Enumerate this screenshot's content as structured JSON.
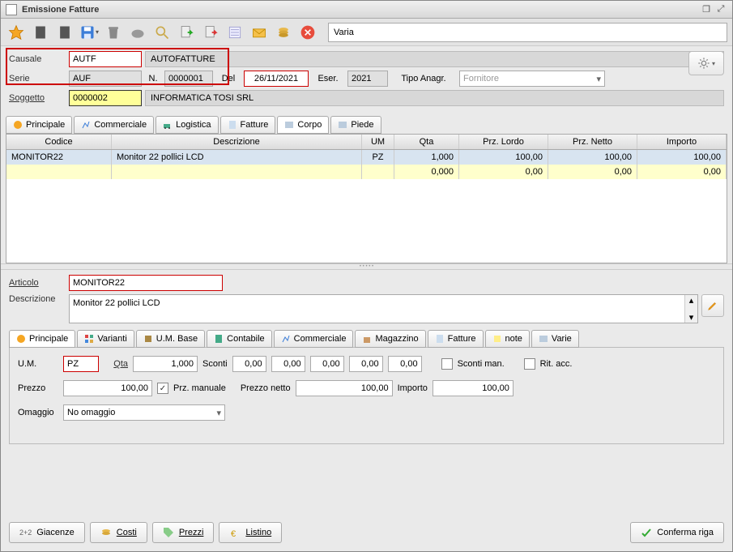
{
  "window": {
    "title": "Emissione Fatture"
  },
  "toolbar": {
    "varia_label": "Varia"
  },
  "header": {
    "causale_label": "Causale",
    "causale_value": "AUTF",
    "causale_desc": "AUTOFATTURE",
    "serie_label": "Serie",
    "serie_value": "AUF",
    "n_label": "N.",
    "n_value": "0000001",
    "del_label": "Del",
    "del_value": "26/11/2021",
    "eser_label": "Eser.",
    "eser_value": "2021",
    "tipoanagr_label": "Tipo Anagr.",
    "tipoanagr_value": "Fornitore",
    "soggetto_label": "Soggetto",
    "soggetto_value": "0000002",
    "soggetto_desc": "INFORMATICA TOSI SRL"
  },
  "tabs": {
    "principale": "Principale",
    "commerciale": "Commerciale",
    "logistica": "Logistica",
    "fatture": "Fatture",
    "corpo": "Corpo",
    "piede": "Piede"
  },
  "grid": {
    "headers": {
      "codice": "Codice",
      "desc": "Descrizione",
      "um": "UM",
      "qta": "Qta",
      "lordo": "Prz. Lordo",
      "netto": "Prz. Netto",
      "importo": "Importo"
    },
    "rows": [
      {
        "codice": "MONITOR22",
        "desc": "Monitor 22 pollici LCD",
        "um": "PZ",
        "qta": "1,000",
        "lordo": "100,00",
        "netto": "100,00",
        "importo": "100,00"
      },
      {
        "codice": "",
        "desc": "",
        "um": "",
        "qta": "0,000",
        "lordo": "0,00",
        "netto": "0,00",
        "importo": "0,00"
      }
    ]
  },
  "detail": {
    "articolo_label": "Articolo",
    "articolo_value": "MONITOR22",
    "descrizione_label": "Descrizione",
    "descrizione_value": "Monitor 22 pollici LCD"
  },
  "subtabs": {
    "principale": "Principale",
    "varianti": "Varianti",
    "umbase": "U.M. Base",
    "contabile": "Contabile",
    "commerciale": "Commerciale",
    "magazzino": "Magazzino",
    "fatture": "Fatture",
    "note": "note",
    "varie": "Varie"
  },
  "fields": {
    "um_label": "U.M.",
    "um_value": "PZ",
    "qta_label": "Qta",
    "qta_value": "1,000",
    "sconti_label": "Sconti",
    "sconto1": "0,00",
    "sconto2": "0,00",
    "sconto3": "0,00",
    "sconto4": "0,00",
    "sconto5": "0,00",
    "scontiman_label": "Sconti man.",
    "ritacc_label": "Rit. acc.",
    "prezzo_label": "Prezzo",
    "prezzo_value": "100,00",
    "przman_label": "Prz. manuale",
    "przman_checked": true,
    "prezzonetto_label": "Prezzo netto",
    "prezzonetto_value": "100,00",
    "importo_label": "Importo",
    "importo_value": "100,00",
    "omaggio_label": "Omaggio",
    "omaggio_value": "No omaggio"
  },
  "footer": {
    "giacenze": "Giacenze",
    "giacenze_prefix": "2+2",
    "costi": "Costi",
    "prezzi": "Prezzi",
    "listino": "Listino",
    "conferma": "Conferma riga"
  }
}
